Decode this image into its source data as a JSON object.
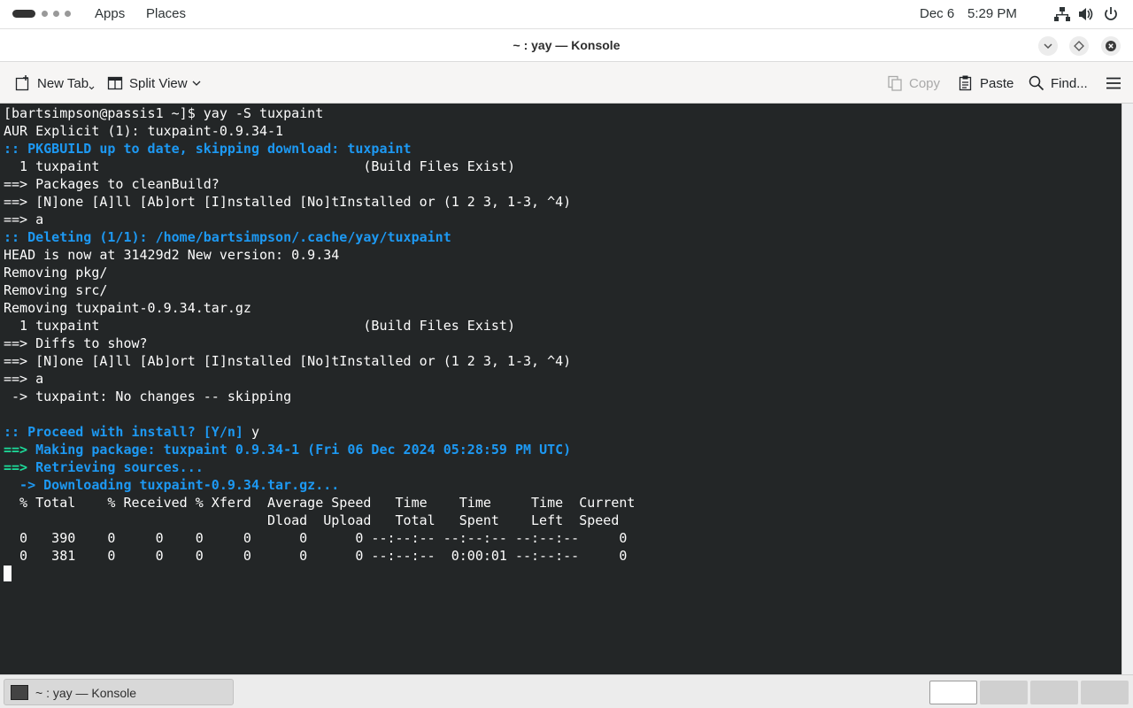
{
  "panel": {
    "apps_label": "Apps",
    "places_label": "Places",
    "date": "Dec 6",
    "time": "5:29 PM"
  },
  "window": {
    "title": "~ : yay — Konsole"
  },
  "toolbar": {
    "new_tab_label": "New Tab",
    "split_view_label": "Split View",
    "copy_label": "Copy",
    "paste_label": "Paste",
    "find_label": "Find..."
  },
  "terminal": {
    "lines": [
      {
        "segments": [
          {
            "text": "[bartsimpson@passis1 ~]$ yay -S tuxpaint",
            "style": ""
          }
        ]
      },
      {
        "segments": [
          {
            "text": "AUR Explicit (1): tuxpaint-0.9.34-1",
            "style": ""
          }
        ]
      },
      {
        "segments": [
          {
            "text": ":: ",
            "style": "b"
          },
          {
            "text": "PKGBUILD up to date, skipping download: tuxpaint",
            "style": "b"
          }
        ]
      },
      {
        "segments": [
          {
            "text": "  1 tuxpaint                                 (Build Files Exist)",
            "style": ""
          }
        ]
      },
      {
        "segments": [
          {
            "text": "==> Packages to cleanBuild?",
            "style": ""
          }
        ]
      },
      {
        "segments": [
          {
            "text": "==> [N]one [A]ll [Ab]ort [I]nstalled [No]tInstalled or (1 2 3, 1-3, ^4)",
            "style": ""
          }
        ]
      },
      {
        "segments": [
          {
            "text": "==> a",
            "style": ""
          }
        ]
      },
      {
        "segments": [
          {
            "text": ":: ",
            "style": "b"
          },
          {
            "text": "Deleting (1/1): /home/bartsimpson/.cache/yay/tuxpaint",
            "style": "b"
          }
        ]
      },
      {
        "segments": [
          {
            "text": "HEAD is now at 31429d2 New version: 0.9.34",
            "style": ""
          }
        ]
      },
      {
        "segments": [
          {
            "text": "Removing pkg/",
            "style": ""
          }
        ]
      },
      {
        "segments": [
          {
            "text": "Removing src/",
            "style": ""
          }
        ]
      },
      {
        "segments": [
          {
            "text": "Removing tuxpaint-0.9.34.tar.gz",
            "style": ""
          }
        ]
      },
      {
        "segments": [
          {
            "text": "  1 tuxpaint                                 (Build Files Exist)",
            "style": ""
          }
        ]
      },
      {
        "segments": [
          {
            "text": "==> Diffs to show?",
            "style": ""
          }
        ]
      },
      {
        "segments": [
          {
            "text": "==> [N]one [A]ll [Ab]ort [I]nstalled [No]tInstalled or (1 2 3, 1-3, ^4)",
            "style": ""
          }
        ]
      },
      {
        "segments": [
          {
            "text": "==> a",
            "style": ""
          }
        ]
      },
      {
        "segments": [
          {
            "text": " -> tuxpaint: No changes -- skipping",
            "style": ""
          }
        ]
      },
      {
        "segments": [
          {
            "text": "",
            "style": ""
          }
        ]
      },
      {
        "segments": [
          {
            "text": ":: ",
            "style": "b"
          },
          {
            "text": "Proceed with install? [Y/n]",
            "style": "b"
          },
          {
            "text": " y",
            "style": ""
          }
        ]
      },
      {
        "segments": [
          {
            "text": "==> ",
            "style": "g"
          },
          {
            "text": "Making package: tuxpaint 0.9.34-1 (Fri 06 Dec 2024 05:28:59 PM UTC)",
            "style": "b"
          }
        ]
      },
      {
        "segments": [
          {
            "text": "==> ",
            "style": "g"
          },
          {
            "text": "Retrieving sources...",
            "style": "b"
          }
        ]
      },
      {
        "segments": [
          {
            "text": "  -> ",
            "style": "b"
          },
          {
            "text": "Downloading tuxpaint-0.9.34.tar.gz...",
            "style": "b"
          }
        ]
      },
      {
        "segments": [
          {
            "text": "  % Total    % Received % Xferd  Average Speed   Time    Time     Time  Current",
            "style": ""
          }
        ]
      },
      {
        "segments": [
          {
            "text": "                                 Dload  Upload   Total   Spent    Left  Speed",
            "style": ""
          }
        ]
      },
      {
        "segments": [
          {
            "text": "  0   390    0     0    0     0      0      0 --:--:-- --:--:-- --:--:--     0",
            "style": ""
          }
        ]
      },
      {
        "segments": [
          {
            "text": "  0   381    0     0    0     0      0      0 --:--:--  0:00:01 --:--:--     0",
            "style": ""
          }
        ]
      }
    ]
  },
  "taskbar": {
    "task_label": "~ : yay — Konsole"
  },
  "colors": {
    "terminal_bg": "#232627",
    "terminal_fg": "#fcfcfc",
    "accent_blue": "#1d99f3",
    "accent_green": "#1cdc9a"
  }
}
